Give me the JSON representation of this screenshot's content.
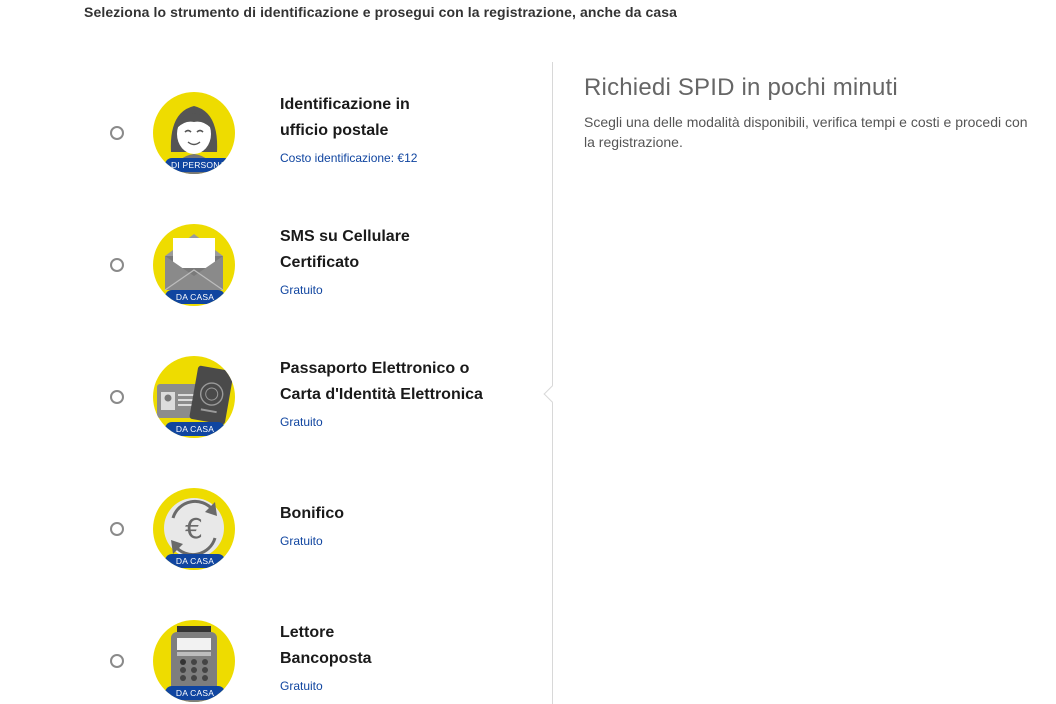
{
  "intro": "Seleziona lo strumento di identificazione e prosegui con la registrazione, anche da casa",
  "options": [
    {
      "title_line1": "Identificazione in",
      "title_line2": "ufficio postale",
      "subtitle": "Costo identificazione: €12",
      "badge": "DI PERSONA",
      "icon": "person-icon"
    },
    {
      "title_line1": "SMS su Cellulare",
      "title_line2": "Certificato",
      "subtitle": "Gratuito",
      "badge": "DA CASA",
      "icon": "envelope-icon"
    },
    {
      "title_line1": "Passaporto Elettronico o",
      "title_line2": "Carta d'Identità Elettronica",
      "subtitle": "Gratuito",
      "badge": "DA CASA",
      "icon": "passport-icon"
    },
    {
      "title_line1": "Bonifico",
      "title_line2": "",
      "subtitle": "Gratuito",
      "badge": "DA CASA",
      "icon": "euro-transfer-icon"
    },
    {
      "title_line1": "Lettore",
      "title_line2": "Bancoposta",
      "subtitle": "Gratuito",
      "badge": "DA CASA",
      "icon": "card-reader-icon"
    }
  ],
  "panel": {
    "title": "Richiedi SPID in pochi minuti",
    "text": "Scegli una delle modalità disponibili, verifica tempi e costi e procedi con la registrazione."
  },
  "colors": {
    "accent_yellow": "#eedc00",
    "brand_blue": "#1045a0"
  }
}
